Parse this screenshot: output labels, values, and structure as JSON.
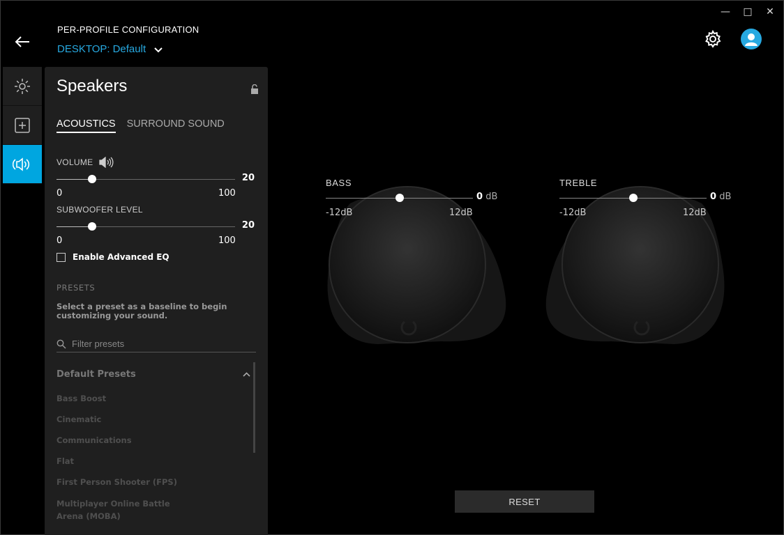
{
  "window": {
    "minimize": "—",
    "maximize": "□",
    "close": "✕"
  },
  "header": {
    "title": "PER-PROFILE CONFIGURATION",
    "profile_scope": "DESKTOP:",
    "profile_name": "Default"
  },
  "rail": {
    "items": [
      "lighting-icon",
      "add-icon",
      "speaker-icon"
    ],
    "active_index": 2
  },
  "panel": {
    "title": "Speakers",
    "tabs": [
      "ACOUSTICS",
      "SURROUND SOUND"
    ],
    "active_tab": 0,
    "volume": {
      "label": "VOLUME",
      "value": "20",
      "min": "0",
      "max": "100",
      "level": 0.2
    },
    "subwoofer": {
      "label": "SUBWOOFER LEVEL",
      "value": "20",
      "min": "0",
      "max": "100",
      "level": 0.2
    },
    "advanced_eq": {
      "label": "Enable Advanced EQ",
      "checked": false
    },
    "presets": {
      "heading": "PRESETS",
      "description": "Select a preset as a baseline to begin customizing your sound.",
      "filter_placeholder": "Filter presets",
      "group": "Default Presets",
      "items": [
        "Bass Boost",
        "Cinematic",
        "Communications",
        "Flat",
        "First Person Shooter (FPS)",
        "Multiplayer Online Battle Arena (MOBA)"
      ]
    }
  },
  "eq": {
    "bass": {
      "label": "BASS",
      "value": "0",
      "unit": "dB",
      "min": "-12dB",
      "max": "12dB",
      "level": 0.5
    },
    "treble": {
      "label": "TREBLE",
      "value": "0",
      "unit": "dB",
      "min": "-12dB",
      "max": "12dB",
      "level": 0.5
    }
  },
  "reset_label": "RESET",
  "colors": {
    "accent": "#00a6e0",
    "link": "#27a9e1",
    "panel": "#1f1f1f"
  }
}
